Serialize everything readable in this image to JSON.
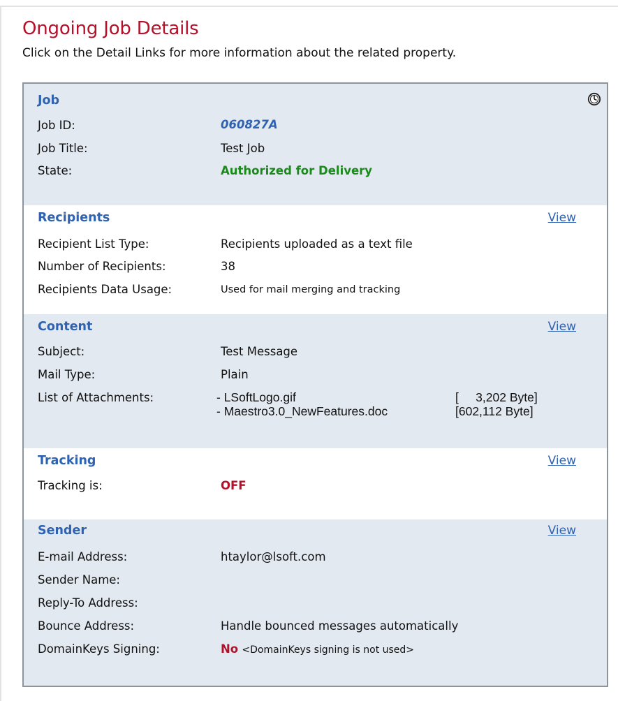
{
  "header": {
    "title": "Ongoing Job Details",
    "subtitle": "Click on the Detail Links for more information about the related property."
  },
  "colors": {
    "title": "#b5102a",
    "section_heading": "#2f62b0",
    "shaded_background": "#e3e9f1",
    "state_green": "#1a8a1a",
    "alert_red": "#b5102a",
    "border": "#8e949c"
  },
  "icons": {
    "job_status": "clock-icon"
  },
  "job": {
    "heading": "Job",
    "job_id_label": "Job ID:",
    "job_id": "060827A",
    "job_title_label": "Job Title:",
    "job_title": "Test Job",
    "state_label": "State:",
    "state": "Authorized for Delivery"
  },
  "recipients": {
    "heading": "Recipients",
    "view_label": "View",
    "list_type_label": "Recipient List Type:",
    "list_type": "Recipients uploaded as a text file",
    "count_label": "Number of Recipients:",
    "count": "38",
    "usage_label": "Recipients Data Usage:",
    "usage": "Used for mail merging and tracking"
  },
  "content": {
    "heading": "Content",
    "view_label": "View",
    "subject_label": "Subject:",
    "subject": "Test Message",
    "mail_type_label": "Mail Type:",
    "mail_type": "Plain",
    "attachments_label": "List of Attachments:",
    "attachments": [
      {
        "name": "- LSoftLogo.gif",
        "size": "[     3,202 Byte]"
      },
      {
        "name": "- Maestro3.0_NewFeatures.doc",
        "size": "[602,112 Byte]"
      }
    ]
  },
  "tracking": {
    "heading": "Tracking",
    "view_label": "View",
    "status_label": "Tracking is:",
    "status": "OFF"
  },
  "sender": {
    "heading": "Sender",
    "view_label": "View",
    "email_label": "E-mail Address:",
    "email": "htaylor@lsoft.com",
    "name_label": "Sender Name:",
    "name": "",
    "reply_to_label": "Reply-To Address:",
    "reply_to": "",
    "bounce_label": "Bounce Address:",
    "bounce": "Handle bounced messages automatically",
    "domainkeys_label": "DomainKeys Signing:",
    "domainkeys_status": "No",
    "domainkeys_note": "<DomainKeys signing is not used>"
  }
}
